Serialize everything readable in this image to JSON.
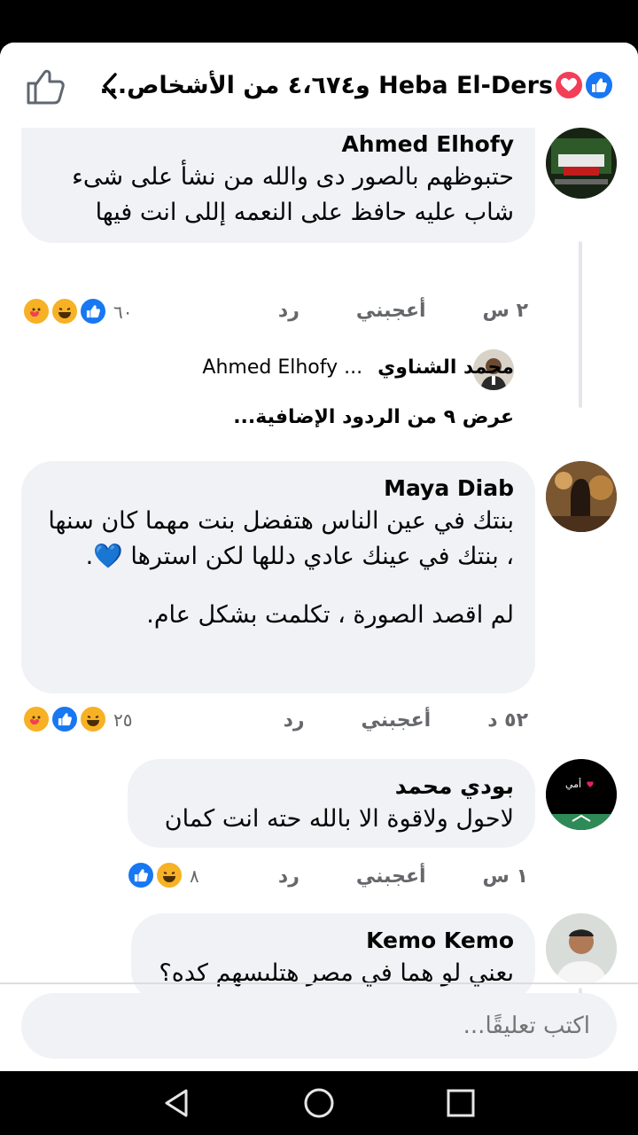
{
  "header": {
    "title": "Heba El-Ders و٤،٦٧٤ من الأشخاص...",
    "like_icon": "thumbs-up-outline-icon",
    "back_icon": "chevron-left-icon"
  },
  "colors": {
    "accent": "#1877f2",
    "love": "#f33e58",
    "haha": "#f7b125",
    "bubble": "#f0f2f5",
    "muted": "#65676b"
  },
  "comments": [
    {
      "name": "Ahmed Elhofy",
      "text": "حتبوظهم بالصور دى والله من نشأ على شىء شاب عليه حافظ على النعمه إللى انت فيها",
      "time": "٢ س",
      "like": "أعجبني",
      "reply": "رد",
      "reactions": "٦٠"
    },
    {
      "name": "Maya Diab",
      "text": "بنتك في عين الناس هتفضل بنت مهما كان سنها ، بنتك في عينك عادي دللها لكن استرها 💙.",
      "text2": "لم اقصد الصورة ، تكلمت بشكل عام.",
      "time": "٥٢ د",
      "like": "أعجبني",
      "reply": "رد",
      "reactions": "٢٥"
    },
    {
      "name": "بودي محمد",
      "text": "لاحول ولاقوة الا بالله حته انت كمان",
      "time": "١ س",
      "like": "أعجبني",
      "reply": "رد",
      "reactions": "٨"
    },
    {
      "name": "Kemo Kemo",
      "text": "يعني لو هما في مصر هتلبسهم كده؟"
    }
  ],
  "reply_preview": {
    "name": "محمد الشناوي",
    "text": "... Ahmed Elhofy"
  },
  "more_replies": "عرض ٩ من الردود الإضافية...",
  "composer": {
    "placeholder": "اكتب تعليقًا..."
  },
  "navbar": {
    "back": "nav-back-icon",
    "home": "nav-home-icon",
    "recents": "nav-recents-icon"
  }
}
